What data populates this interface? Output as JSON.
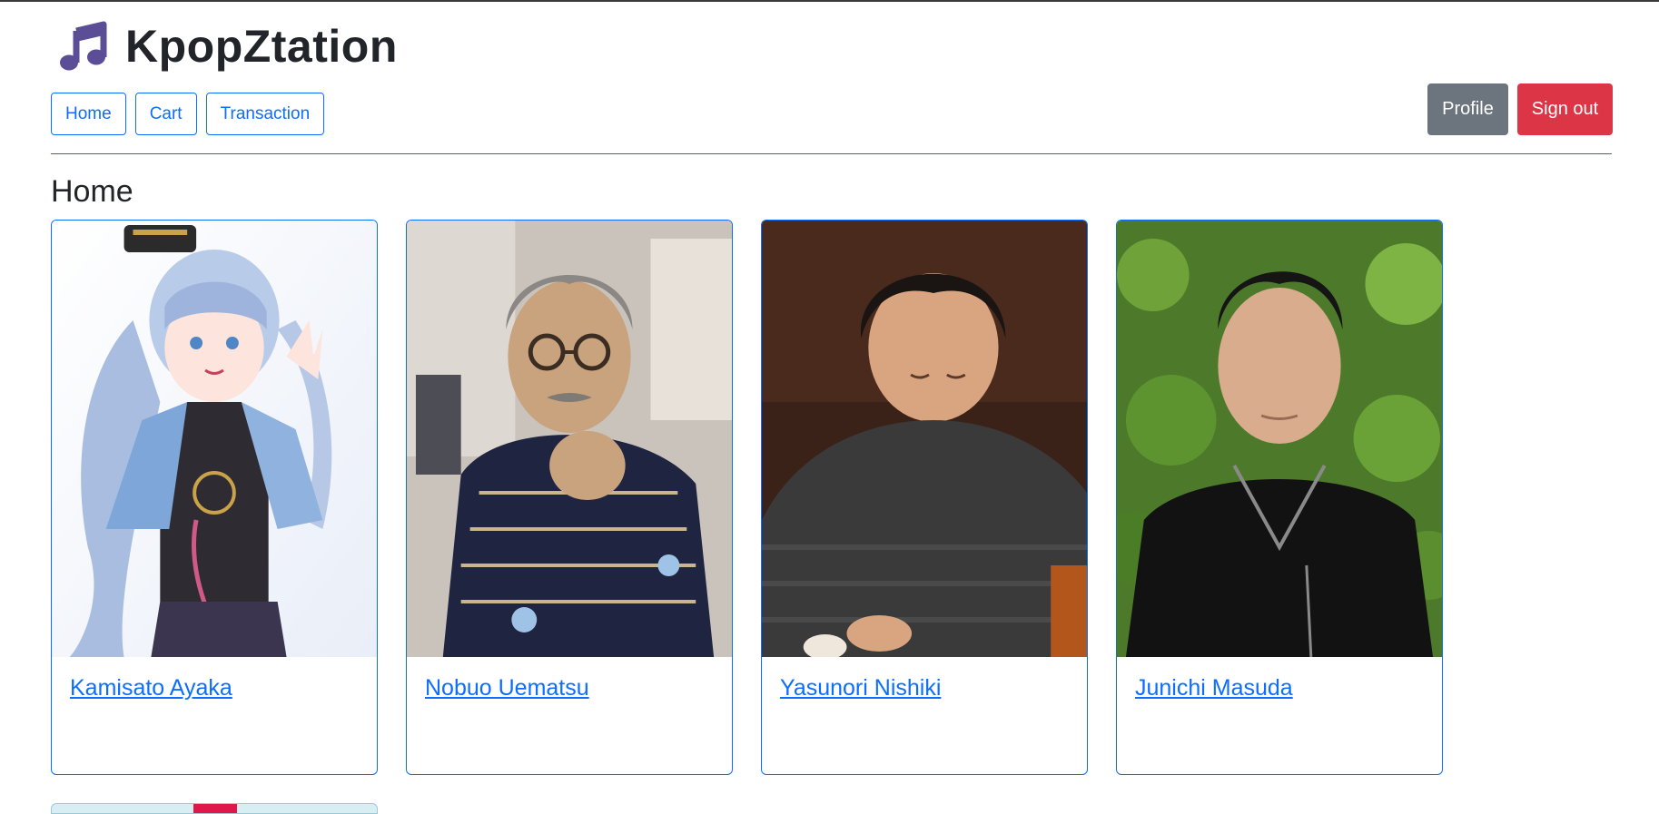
{
  "app": {
    "title": "KpopZtation",
    "logo_icon": "music-note-icon",
    "logo_color": "#5b4e96"
  },
  "nav": {
    "items": [
      {
        "label": "Home"
      },
      {
        "label": "Cart"
      },
      {
        "label": "Transaction"
      }
    ]
  },
  "actions": {
    "profile_label": "Profile",
    "signout_label": "Sign out"
  },
  "page": {
    "title": "Home"
  },
  "artists": [
    {
      "name": "Kamisato Ayaka"
    },
    {
      "name": "Nobuo Uematsu"
    },
    {
      "name": "Yasunori Nishiki"
    },
    {
      "name": "Junichi Masuda"
    }
  ],
  "colors": {
    "primary": "#0d6efd",
    "secondary": "#6c757d",
    "danger": "#dc3545",
    "divider": "#1b6ec2"
  }
}
